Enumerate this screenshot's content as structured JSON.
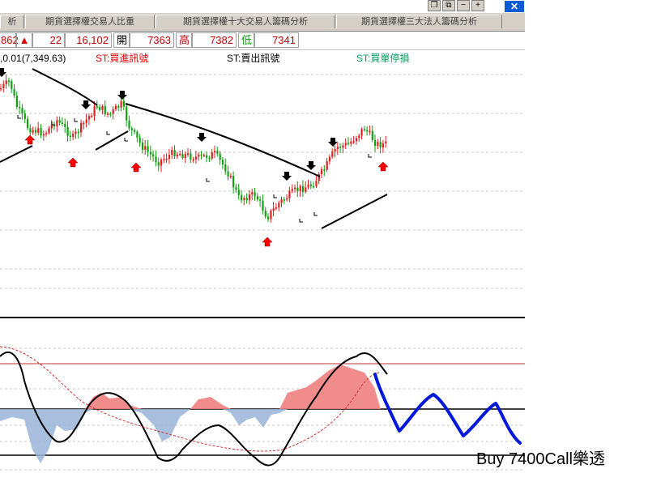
{
  "tabs": [
    {
      "label": "析"
    },
    {
      "label": "期貨選擇權交易人比重"
    },
    {
      "label": "期貨選擇權十大交易人籌碼分析"
    },
    {
      "label": "期貨選擇權三大法人籌碼分析"
    }
  ],
  "window_controls": {
    "restore": "❐",
    "copy": "⧉",
    "minimize": "−",
    "maximize": "+",
    "close": "✕"
  },
  "quote": {
    "partial_value": "862",
    "change_arrow": "▲",
    "change": "22",
    "volume": "16,102",
    "open_label": "開",
    "open": "7363",
    "high_label": "高",
    "high": "7382",
    "low_label": "低",
    "low": "7341"
  },
  "legend": {
    "indicator_text": ",0.01(7,349.63)",
    "buy_signal": "ST:買進訊號",
    "sell_signal": "ST:賣出訊號",
    "buy_stop": "ST:買單停損"
  },
  "overlay_text": "Buy 7400Call樂透",
  "colors": {
    "candle_up": "#e02020",
    "candle_down": "#10a010",
    "buy_arrow": "#ff0000",
    "sell_arrow": "#000000",
    "area_positive": "#f08080",
    "area_negative": "#9ab4d8",
    "projection": "#0018d8",
    "legend_buy": "#e00000",
    "legend_buy_stop": "#00a060"
  }
}
